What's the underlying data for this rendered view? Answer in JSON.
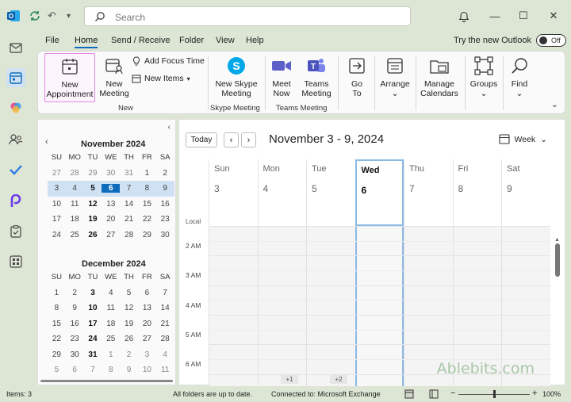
{
  "titlebar": {
    "search_placeholder": "Search",
    "undo_glyph": "↶",
    "dropdown_glyph": "▾",
    "minimize_glyph": "—",
    "maximize_glyph": "☐",
    "close_glyph": "✕"
  },
  "menu": {
    "tabs": [
      "File",
      "Home",
      "Send / Receive",
      "Folder",
      "View",
      "Help"
    ],
    "active_tab": "Home",
    "try_new": "Try the new Outlook",
    "toggle_label": "Off"
  },
  "ribbon": {
    "new_appointment": "New\nAppointment",
    "new_meeting": "New\nMeeting",
    "add_focus_time": "Add Focus Time",
    "new_items": "New Items",
    "group_new": "New",
    "new_skype_meeting": "New Skype\nMeeting",
    "group_skype": "Skype Meeting",
    "meet_now": "Meet\nNow",
    "teams_meeting": "Teams\nMeeting",
    "group_teams": "Teams Meeting",
    "go_to": "Go\nTo",
    "arrange": "Arrange",
    "manage_calendars": "Manage\nCalendars",
    "groups": "Groups",
    "find": "Find",
    "dropdown_glyph": "⌄"
  },
  "minical": [
    {
      "title": "November 2024",
      "headers": [
        "SU",
        "MO",
        "TU",
        "WE",
        "TH",
        "FR",
        "SA"
      ],
      "rows": [
        [
          "27",
          "28",
          "29",
          "30",
          "31",
          "1",
          "2"
        ],
        [
          "3",
          "4",
          "5",
          "6",
          "7",
          "8",
          "9"
        ],
        [
          "10",
          "11",
          "12",
          "13",
          "14",
          "15",
          "16"
        ],
        [
          "17",
          "18",
          "19",
          "20",
          "21",
          "22",
          "23"
        ],
        [
          "24",
          "25",
          "26",
          "27",
          "28",
          "29",
          "30"
        ]
      ]
    },
    {
      "title": "December 2024",
      "headers": [
        "SU",
        "MO",
        "TU",
        "WE",
        "TH",
        "FR",
        "SA"
      ],
      "rows": [
        [
          "1",
          "2",
          "3",
          "4",
          "5",
          "6",
          "7"
        ],
        [
          "8",
          "9",
          "10",
          "11",
          "12",
          "13",
          "14"
        ],
        [
          "15",
          "16",
          "17",
          "18",
          "19",
          "20",
          "21"
        ],
        [
          "22",
          "23",
          "24",
          "25",
          "26",
          "27",
          "28"
        ],
        [
          "29",
          "30",
          "31",
          "1",
          "2",
          "3",
          "4"
        ],
        [
          "5",
          "6",
          "7",
          "8",
          "9",
          "10",
          "11"
        ]
      ]
    }
  ],
  "calendar": {
    "today_button": "Today",
    "prev_glyph": "‹",
    "next_glyph": "›",
    "range_title": "November 3 - 9, 2024",
    "view_label": "Week",
    "view_chevron": "⌄",
    "days": [
      {
        "name": "Sun",
        "num": "3"
      },
      {
        "name": "Mon",
        "num": "4"
      },
      {
        "name": "Tue",
        "num": "5"
      },
      {
        "name": "Wed",
        "num": "6"
      },
      {
        "name": "Thu",
        "num": "7"
      },
      {
        "name": "Fri",
        "num": "8"
      },
      {
        "name": "Sat",
        "num": "9"
      }
    ],
    "current_day_index": 3,
    "timezone_label": "Local",
    "hours": [
      "2 AM",
      "3 AM",
      "4 AM",
      "5 AM",
      "6 AM"
    ],
    "more_badges": [
      "+1",
      "+2"
    ],
    "watermark": "Ablebits.com"
  },
  "status": {
    "items": "Items: 3",
    "sync": "All folders are up to date.",
    "connection": "Connected to: Microsoft Exchange",
    "zoom_minus": "−",
    "zoom_plus": "+",
    "zoom": "100%",
    "zoom_level": 0.5
  },
  "colors": {
    "accent": "#0f6cbd",
    "chrome": "#dde6d4",
    "highlight": "#e388e3"
  }
}
